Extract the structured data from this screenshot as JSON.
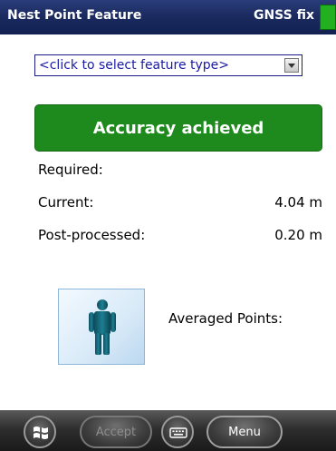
{
  "titlebar": {
    "title": "Nest Point Feature",
    "gnss_status": "GNSS fix",
    "gnss_indicator_color": "#22b020"
  },
  "feature_select": {
    "value": "<click to select feature type>"
  },
  "accuracy": {
    "banner": "Accuracy achieved",
    "banner_color": "#1e8a1e"
  },
  "metrics": {
    "required_label": "Required:",
    "required_value": "",
    "current_label": "Current:",
    "current_value": "4.04 m",
    "post_label": "Post-processed:",
    "post_value": "0.20 m"
  },
  "averaged": {
    "label": "Averaged Points:",
    "icon": "person-standing-icon"
  },
  "bottombar": {
    "start_icon": "windows-start-icon",
    "accept_label": "Accept",
    "keyboard_icon": "keyboard-icon",
    "menu_label": "Menu"
  }
}
